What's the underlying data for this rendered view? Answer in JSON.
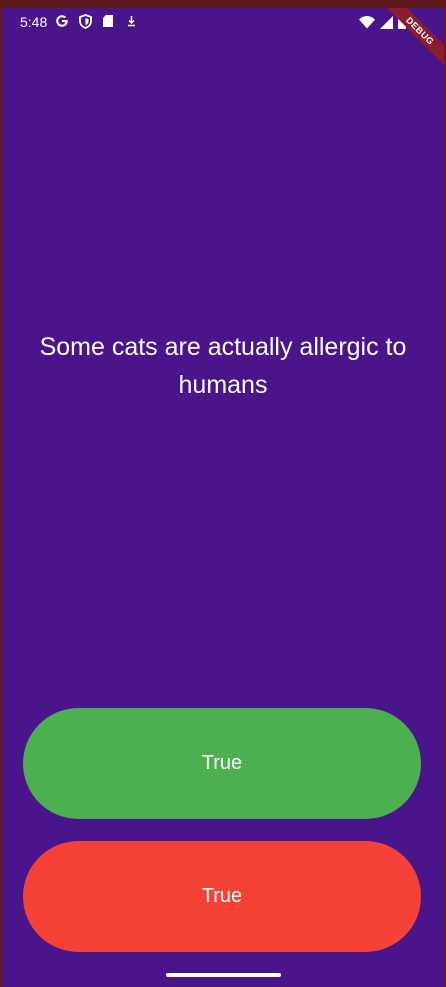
{
  "status_bar": {
    "time": "5:48",
    "left_icons": [
      "google-icon",
      "shield-icon",
      "sd-card-icon",
      "download-icon"
    ],
    "right_icons": [
      "wifi-icon",
      "signal-icon",
      "battery-icon"
    ]
  },
  "debug_banner": {
    "label": "DEBUG"
  },
  "quiz": {
    "question": "Some cats are actually allergic to humans"
  },
  "buttons": {
    "true_label": "True",
    "false_label": "True",
    "true_color": "#4caf50",
    "false_color": "#f44336"
  },
  "colors": {
    "background": "#4a158a",
    "debug_ribbon": "#8b1e2e"
  }
}
